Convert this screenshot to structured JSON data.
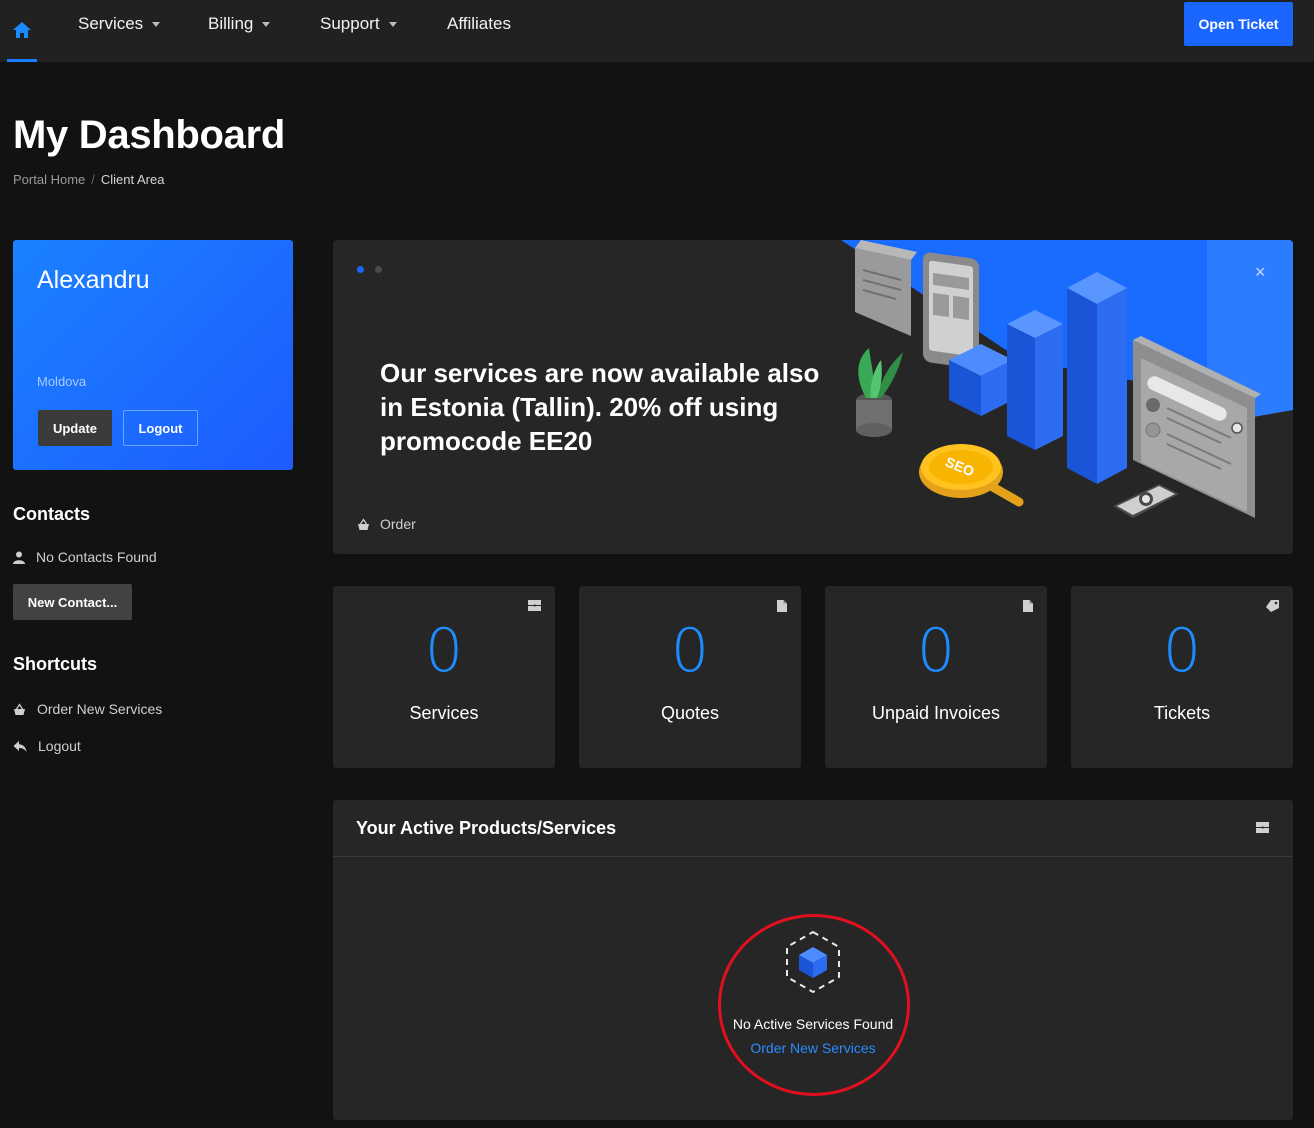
{
  "nav": {
    "items": [
      {
        "label": "Services",
        "dropdown": true
      },
      {
        "label": "Billing",
        "dropdown": true
      },
      {
        "label": "Support",
        "dropdown": true
      },
      {
        "label": "Affiliates",
        "dropdown": false
      }
    ],
    "open_ticket": "Open Ticket"
  },
  "header": {
    "title": "My Dashboard",
    "breadcrumb": [
      "Portal Home",
      "Client Area"
    ]
  },
  "profile": {
    "name": "Alexandru",
    "country": "Moldova",
    "update_label": "Update",
    "logout_label": "Logout"
  },
  "contacts": {
    "heading": "Contacts",
    "empty": "No Contacts Found",
    "new_label": "New Contact..."
  },
  "shortcuts": {
    "heading": "Shortcuts",
    "items": [
      {
        "label": "Order New Services",
        "icon": "basket-icon"
      },
      {
        "label": "Logout",
        "icon": "reply-arrow-icon"
      }
    ]
  },
  "banner": {
    "headline": "Our services are now available also in Estonia (Tallin). 20% off using promocode EE20",
    "order_label": "Order",
    "close_symbol": "×",
    "illustration_seo_text": "SEO",
    "slides": 2,
    "active_slide": 1
  },
  "stats": [
    {
      "value": "0",
      "label": "Services",
      "icon": "server-icon"
    },
    {
      "value": "0",
      "label": "Quotes",
      "icon": "document-icon"
    },
    {
      "value": "0",
      "label": "Unpaid Invoices",
      "icon": "document-icon"
    },
    {
      "value": "0",
      "label": "Tickets",
      "icon": "tag-icon"
    }
  ],
  "products": {
    "title": "Your Active Products/Services",
    "empty_text": "No Active Services Found",
    "order_link": "Order New Services"
  },
  "colors": {
    "accent": "#1a66ff",
    "number_blue": "#1e8bff",
    "highlight_red": "#e01020"
  }
}
